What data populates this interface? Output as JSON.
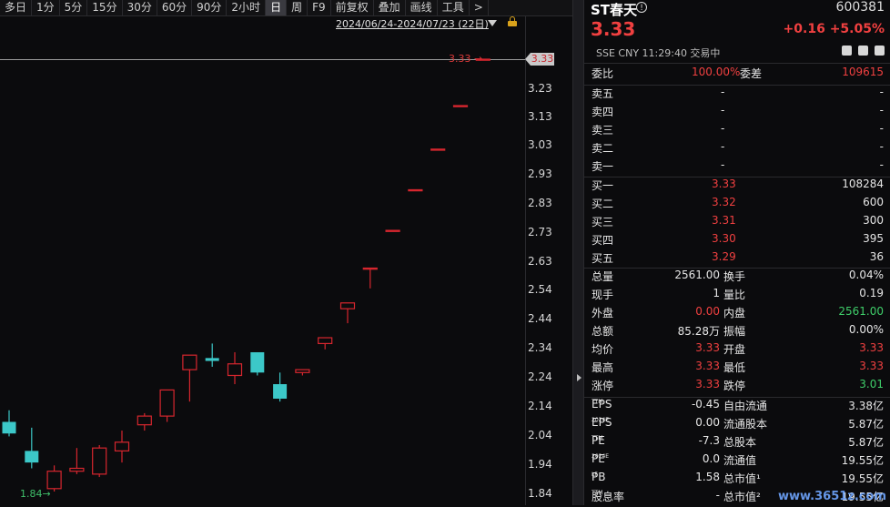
{
  "toolbar": {
    "items": [
      "多日",
      "1分",
      "5分",
      "15分",
      "30分",
      "60分",
      "90分",
      "2小时",
      "日",
      "周",
      "F9",
      "前复权",
      "叠加",
      "画线",
      "工具",
      ">"
    ],
    "active_index": 8
  },
  "chart": {
    "range_label": "2024/06/24-2024/07/23 (22日)",
    "current_price_tag": "3.33",
    "high_label": "3.33",
    "low_label": "1.84",
    "y_ticks": [
      "3.33",
      "3.23",
      "3.13",
      "3.03",
      "2.93",
      "2.83",
      "2.73",
      "2.63",
      "2.54",
      "2.44",
      "2.34",
      "2.24",
      "2.14",
      "2.04",
      "1.94",
      "1.84"
    ],
    "up_color": "#d7262e",
    "down_color": "#3cc8c8"
  },
  "chart_data": {
    "type": "candlestick",
    "title": "",
    "ylim": [
      1.84,
      3.33
    ],
    "series": [
      {
        "open": 2.08,
        "close": 2.04,
        "high": 2.12,
        "low": 2.03
      },
      {
        "open": 1.98,
        "close": 1.94,
        "high": 2.06,
        "low": 1.92
      },
      {
        "open": 1.85,
        "close": 1.91,
        "high": 1.93,
        "low": 1.84
      },
      {
        "open": 1.91,
        "close": 1.92,
        "high": 1.99,
        "low": 1.9
      },
      {
        "open": 1.9,
        "close": 1.99,
        "high": 2.0,
        "low": 1.89
      },
      {
        "open": 1.98,
        "close": 2.01,
        "high": 2.05,
        "low": 1.94
      },
      {
        "open": 2.07,
        "close": 2.1,
        "high": 2.11,
        "low": 2.05
      },
      {
        "open": 2.1,
        "close": 2.19,
        "high": 2.19,
        "low": 2.08
      },
      {
        "open": 2.26,
        "close": 2.31,
        "high": 2.31,
        "low": 2.15
      },
      {
        "open": 2.3,
        "close": 2.29,
        "high": 2.35,
        "low": 2.27
      },
      {
        "open": 2.24,
        "close": 2.28,
        "high": 2.32,
        "low": 2.21
      },
      {
        "open": 2.32,
        "close": 2.25,
        "high": 2.32,
        "low": 2.24
      },
      {
        "open": 2.21,
        "close": 2.16,
        "high": 2.25,
        "low": 2.15
      },
      {
        "open": 2.25,
        "close": 2.26,
        "high": 2.26,
        "low": 2.24
      },
      {
        "open": 2.35,
        "close": 2.37,
        "high": 2.37,
        "low": 2.33
      },
      {
        "open": 2.47,
        "close": 2.49,
        "high": 2.49,
        "low": 2.42
      },
      {
        "open": 2.61,
        "close": 2.61,
        "high": 2.61,
        "low": 2.54
      },
      {
        "open": 2.74,
        "close": 2.74,
        "high": 2.74,
        "low": 2.74
      },
      {
        "open": 2.88,
        "close": 2.88,
        "high": 2.88,
        "low": 2.88
      },
      {
        "open": 3.02,
        "close": 3.02,
        "high": 3.02,
        "low": 3.02
      },
      {
        "open": 3.17,
        "close": 3.17,
        "high": 3.17,
        "low": 3.17
      },
      {
        "open": 3.33,
        "close": 3.33,
        "high": 3.33,
        "low": 3.33
      }
    ]
  },
  "quote": {
    "name": "ST春天",
    "code": "600381",
    "price": "3.33",
    "change": "+0.16",
    "change_pct": "+5.05%",
    "meta": "SSE  CNY  11:29:40  交易中",
    "weibi_label": "委比",
    "weibi_value": "100.00%",
    "weicha_label": "委差",
    "weicha_value": "109615",
    "asks": [
      {
        "label": "卖五",
        "price": "-",
        "vol": "-"
      },
      {
        "label": "卖四",
        "price": "-",
        "vol": "-"
      },
      {
        "label": "卖三",
        "price": "-",
        "vol": "-"
      },
      {
        "label": "卖二",
        "price": "-",
        "vol": "-"
      },
      {
        "label": "卖一",
        "price": "-",
        "vol": "-"
      }
    ],
    "bids": [
      {
        "label": "买一",
        "price": "3.33",
        "vol": "108284"
      },
      {
        "label": "买二",
        "price": "3.32",
        "vol": "600"
      },
      {
        "label": "买三",
        "price": "3.31",
        "vol": "300"
      },
      {
        "label": "买四",
        "price": "3.30",
        "vol": "395"
      },
      {
        "label": "买五",
        "price": "3.29",
        "vol": "36"
      }
    ],
    "stats": [
      {
        "l1": "总量",
        "v1": "2561.00",
        "c1": "white",
        "l2": "换手",
        "v2": "0.04%",
        "c2": "white"
      },
      {
        "l1": "现手",
        "v1": "1",
        "c1": "white",
        "l2": "量比",
        "v2": "0.19",
        "c2": "white"
      },
      {
        "l1": "外盘",
        "v1": "0.00",
        "c1": "red",
        "l2": "内盘",
        "v2": "2561.00",
        "c2": "green"
      },
      {
        "l1": "总额",
        "v1": "85.28万",
        "c1": "white",
        "l2": "振幅",
        "v2": "0.00%",
        "c2": "white"
      },
      {
        "l1": "均价",
        "v1": "3.33",
        "c1": "red",
        "l2": "开盘",
        "v2": "3.33",
        "c2": "red"
      },
      {
        "l1": "最高",
        "v1": "3.33",
        "c1": "red",
        "l2": "最低",
        "v2": "3.33",
        "c2": "red"
      },
      {
        "l1": "涨停",
        "v1": "3.33",
        "c1": "red",
        "l2": "跌停",
        "v2": "3.01",
        "c2": "green"
      }
    ],
    "fund": [
      {
        "l1": "EPS",
        "s1": "TTM",
        "v1": "-0.45",
        "l2": "自由流通",
        "v2": "3.38亿"
      },
      {
        "l1": "EPS",
        "s1": "2024E",
        "v1": "0.00",
        "l2": "流通股本",
        "v2": "5.87亿"
      },
      {
        "l1": "PE",
        "s1": "TTM",
        "v1": "-7.3",
        "l2": "总股本",
        "v2": "5.87亿"
      },
      {
        "l1": "PE",
        "s1": "2024E",
        "v1": "0.0",
        "l2": "流通值",
        "v2": "19.55亿"
      },
      {
        "l1": "PB",
        "s1": "LF",
        "v1": "1.58",
        "l2": "总市值¹",
        "v2": "19.55亿"
      },
      {
        "l1": "股息率",
        "s1": "TTM",
        "v1": "-",
        "l2": "总市值²",
        "v2": "19.55亿"
      }
    ]
  },
  "watermark": "www.3651z.com"
}
